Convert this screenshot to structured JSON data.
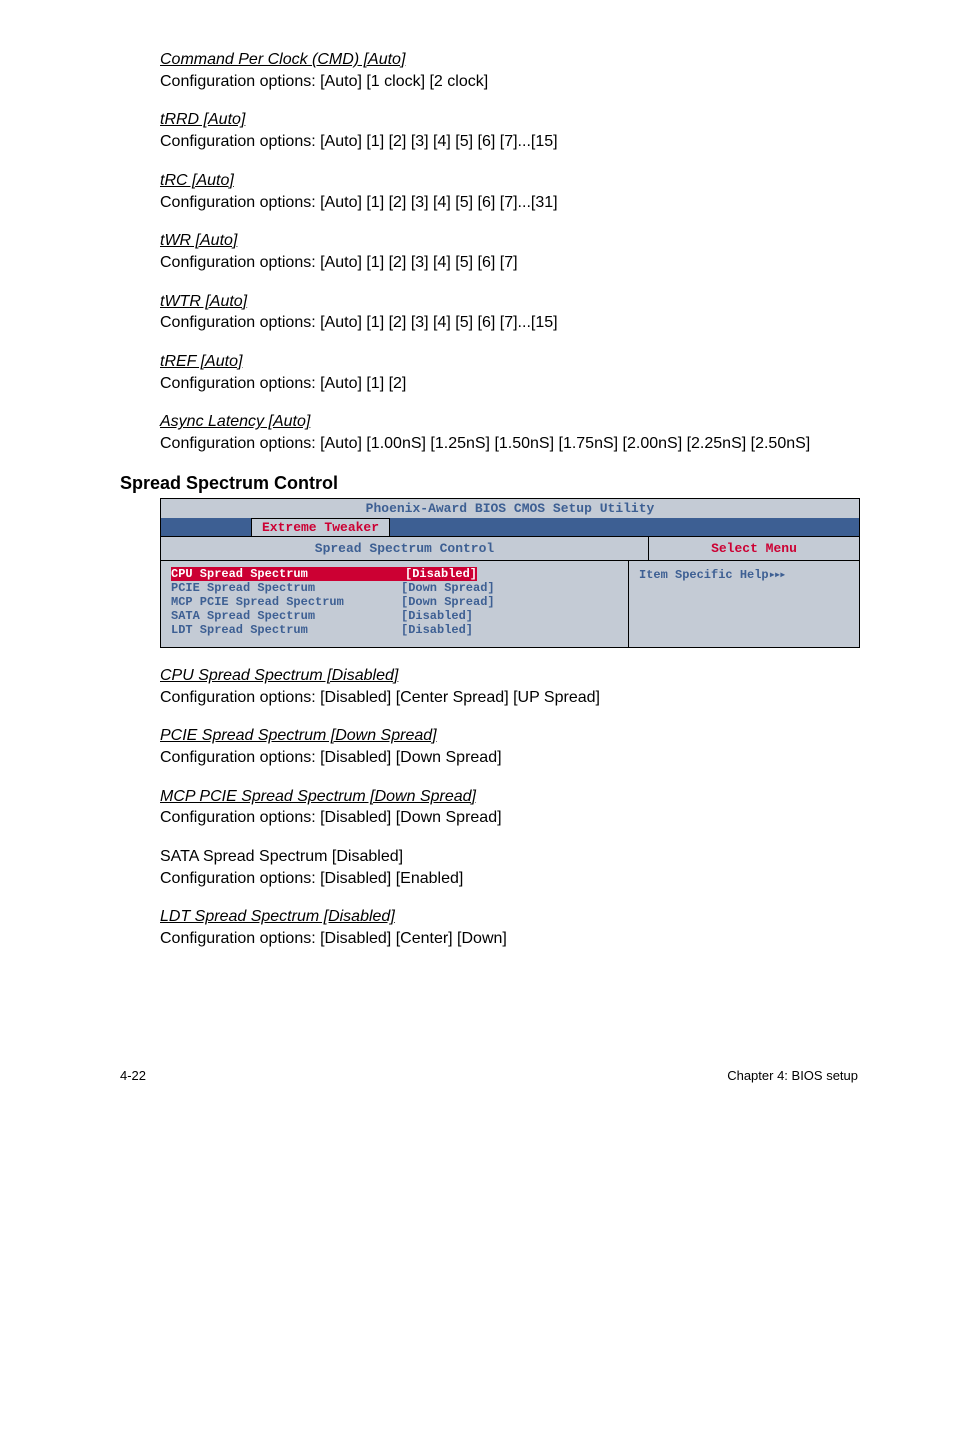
{
  "options": {
    "cmd": {
      "title": "Command Per Clock (CMD) [Auto]",
      "desc": "Configuration options: [Auto] [1 clock] [2 clock]"
    },
    "trrd": {
      "title": "tRRD [Auto]",
      "desc": "Configuration options: [Auto] [1] [2] [3] [4] [5] [6] [7]...[15]"
    },
    "trc": {
      "title": "tRC [Auto]",
      "desc": "Configuration options: [Auto] [1] [2] [3] [4] [5] [6] [7]...[31]"
    },
    "twr": {
      "title": "tWR [Auto]",
      "desc": "Configuration options: [Auto] [1] [2] [3] [4] [5] [6] [7]"
    },
    "twtr": {
      "title": "tWTR [Auto]",
      "desc": "Configuration options: [Auto] [1] [2] [3] [4] [5] [6] [7]...[15]"
    },
    "tref": {
      "title": "tREF [Auto]",
      "desc": "Configuration options: [Auto] [1] [2]"
    },
    "async": {
      "title": "Async Latency [Auto]",
      "desc": "Configuration options: [Auto] [1.00nS] [1.25nS] [1.50nS] [1.75nS] [2.00nS] [2.25nS] [2.50nS]"
    }
  },
  "section_heading": "Spread Spectrum Control",
  "bios": {
    "utility_title": "Phoenix-Award BIOS CMOS Setup Utility",
    "tab": "Extreme Tweaker",
    "left_header": "Spread Spectrum Control",
    "right_header": "Select Menu",
    "help_text": "Item Specific Help",
    "rows": [
      {
        "key": "CPU Spread Spectrum",
        "val": "[Disabled]",
        "highlight": true
      },
      {
        "key": "PCIE Spread Spectrum",
        "val": "[Down Spread]",
        "highlight": false
      },
      {
        "key": "MCP PCIE Spread Spectrum",
        "val": "[Down Spread]",
        "highlight": false
      },
      {
        "key": "SATA Spread Spectrum",
        "val": "[Disabled]",
        "highlight": false
      },
      {
        "key": "LDT Spread Spectrum",
        "val": "[Disabled]",
        "highlight": false
      }
    ]
  },
  "post_options": {
    "cpu_ss": {
      "title": "CPU Spread Spectrum [Disabled]",
      "desc": "Configuration options: [Disabled] [Center Spread] [UP Spread]"
    },
    "pcie_ss": {
      "title": "PCIE Spread Spectrum [Down Spread]",
      "title_trail": " ",
      "desc": "Configuration options: [Disabled] [Down Spread]"
    },
    "mcp_ss": {
      "title": "MCP PCIE Spread Spectrum [Down Spread]",
      "title_trail": " ",
      "desc": "Configuration options: [Disabled] [Down Spread]"
    },
    "sata_ss": {
      "title_plain": "SATA Spread Spectrum [Disabled]",
      "desc": "Configuration options: [Disabled] [Enabled]"
    },
    "ldt_ss": {
      "title": "LDT Spread Spectrum [Disabled]",
      "desc": "Configuration options: [Disabled] [Center] [Down]"
    }
  },
  "footer": {
    "left": "4-22",
    "right": "Chapter 4: BIOS setup"
  }
}
